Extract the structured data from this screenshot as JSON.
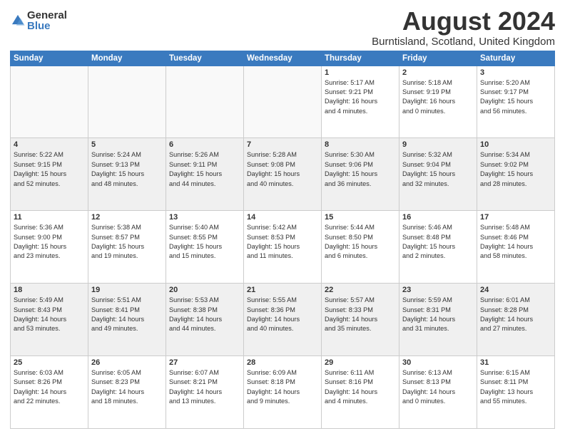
{
  "logo": {
    "general": "General",
    "blue": "Blue"
  },
  "title": "August 2024",
  "location": "Burntisland, Scotland, United Kingdom",
  "days_of_week": [
    "Sunday",
    "Monday",
    "Tuesday",
    "Wednesday",
    "Thursday",
    "Friday",
    "Saturday"
  ],
  "weeks": [
    [
      {
        "day": "",
        "info": "",
        "empty": true
      },
      {
        "day": "",
        "info": "",
        "empty": true
      },
      {
        "day": "",
        "info": "",
        "empty": true
      },
      {
        "day": "",
        "info": "",
        "empty": true
      },
      {
        "day": "1",
        "info": "Sunrise: 5:17 AM\nSunset: 9:21 PM\nDaylight: 16 hours\nand 4 minutes.",
        "empty": false
      },
      {
        "day": "2",
        "info": "Sunrise: 5:18 AM\nSunset: 9:19 PM\nDaylight: 16 hours\nand 0 minutes.",
        "empty": false
      },
      {
        "day": "3",
        "info": "Sunrise: 5:20 AM\nSunset: 9:17 PM\nDaylight: 15 hours\nand 56 minutes.",
        "empty": false
      }
    ],
    [
      {
        "day": "4",
        "info": "Sunrise: 5:22 AM\nSunset: 9:15 PM\nDaylight: 15 hours\nand 52 minutes.",
        "empty": false
      },
      {
        "day": "5",
        "info": "Sunrise: 5:24 AM\nSunset: 9:13 PM\nDaylight: 15 hours\nand 48 minutes.",
        "empty": false
      },
      {
        "day": "6",
        "info": "Sunrise: 5:26 AM\nSunset: 9:11 PM\nDaylight: 15 hours\nand 44 minutes.",
        "empty": false
      },
      {
        "day": "7",
        "info": "Sunrise: 5:28 AM\nSunset: 9:08 PM\nDaylight: 15 hours\nand 40 minutes.",
        "empty": false
      },
      {
        "day": "8",
        "info": "Sunrise: 5:30 AM\nSunset: 9:06 PM\nDaylight: 15 hours\nand 36 minutes.",
        "empty": false
      },
      {
        "day": "9",
        "info": "Sunrise: 5:32 AM\nSunset: 9:04 PM\nDaylight: 15 hours\nand 32 minutes.",
        "empty": false
      },
      {
        "day": "10",
        "info": "Sunrise: 5:34 AM\nSunset: 9:02 PM\nDaylight: 15 hours\nand 28 minutes.",
        "empty": false
      }
    ],
    [
      {
        "day": "11",
        "info": "Sunrise: 5:36 AM\nSunset: 9:00 PM\nDaylight: 15 hours\nand 23 minutes.",
        "empty": false
      },
      {
        "day": "12",
        "info": "Sunrise: 5:38 AM\nSunset: 8:57 PM\nDaylight: 15 hours\nand 19 minutes.",
        "empty": false
      },
      {
        "day": "13",
        "info": "Sunrise: 5:40 AM\nSunset: 8:55 PM\nDaylight: 15 hours\nand 15 minutes.",
        "empty": false
      },
      {
        "day": "14",
        "info": "Sunrise: 5:42 AM\nSunset: 8:53 PM\nDaylight: 15 hours\nand 11 minutes.",
        "empty": false
      },
      {
        "day": "15",
        "info": "Sunrise: 5:44 AM\nSunset: 8:50 PM\nDaylight: 15 hours\nand 6 minutes.",
        "empty": false
      },
      {
        "day": "16",
        "info": "Sunrise: 5:46 AM\nSunset: 8:48 PM\nDaylight: 15 hours\nand 2 minutes.",
        "empty": false
      },
      {
        "day": "17",
        "info": "Sunrise: 5:48 AM\nSunset: 8:46 PM\nDaylight: 14 hours\nand 58 minutes.",
        "empty": false
      }
    ],
    [
      {
        "day": "18",
        "info": "Sunrise: 5:49 AM\nSunset: 8:43 PM\nDaylight: 14 hours\nand 53 minutes.",
        "empty": false
      },
      {
        "day": "19",
        "info": "Sunrise: 5:51 AM\nSunset: 8:41 PM\nDaylight: 14 hours\nand 49 minutes.",
        "empty": false
      },
      {
        "day": "20",
        "info": "Sunrise: 5:53 AM\nSunset: 8:38 PM\nDaylight: 14 hours\nand 44 minutes.",
        "empty": false
      },
      {
        "day": "21",
        "info": "Sunrise: 5:55 AM\nSunset: 8:36 PM\nDaylight: 14 hours\nand 40 minutes.",
        "empty": false
      },
      {
        "day": "22",
        "info": "Sunrise: 5:57 AM\nSunset: 8:33 PM\nDaylight: 14 hours\nand 35 minutes.",
        "empty": false
      },
      {
        "day": "23",
        "info": "Sunrise: 5:59 AM\nSunset: 8:31 PM\nDaylight: 14 hours\nand 31 minutes.",
        "empty": false
      },
      {
        "day": "24",
        "info": "Sunrise: 6:01 AM\nSunset: 8:28 PM\nDaylight: 14 hours\nand 27 minutes.",
        "empty": false
      }
    ],
    [
      {
        "day": "25",
        "info": "Sunrise: 6:03 AM\nSunset: 8:26 PM\nDaylight: 14 hours\nand 22 minutes.",
        "empty": false
      },
      {
        "day": "26",
        "info": "Sunrise: 6:05 AM\nSunset: 8:23 PM\nDaylight: 14 hours\nand 18 minutes.",
        "empty": false
      },
      {
        "day": "27",
        "info": "Sunrise: 6:07 AM\nSunset: 8:21 PM\nDaylight: 14 hours\nand 13 minutes.",
        "empty": false
      },
      {
        "day": "28",
        "info": "Sunrise: 6:09 AM\nSunset: 8:18 PM\nDaylight: 14 hours\nand 9 minutes.",
        "empty": false
      },
      {
        "day": "29",
        "info": "Sunrise: 6:11 AM\nSunset: 8:16 PM\nDaylight: 14 hours\nand 4 minutes.",
        "empty": false
      },
      {
        "day": "30",
        "info": "Sunrise: 6:13 AM\nSunset: 8:13 PM\nDaylight: 14 hours\nand 0 minutes.",
        "empty": false
      },
      {
        "day": "31",
        "info": "Sunrise: 6:15 AM\nSunset: 8:11 PM\nDaylight: 13 hours\nand 55 minutes.",
        "empty": false
      }
    ]
  ]
}
